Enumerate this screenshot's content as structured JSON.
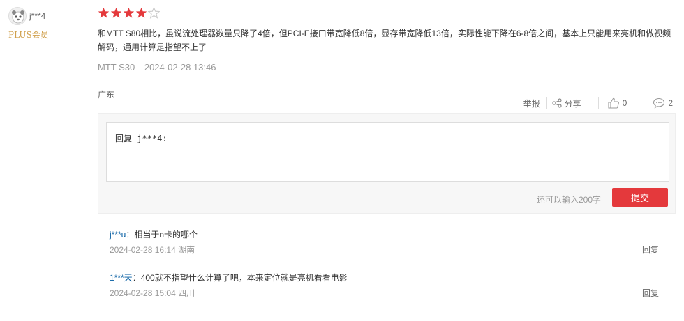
{
  "user": {
    "name": "j***4",
    "badge": "PLUS会员"
  },
  "review": {
    "rating": 4,
    "max_rating": 5,
    "text": "和MTT S80相比，虽说流处理器数量只降了4倍，但PCI-E接口带宽降低8倍，显存带宽降低13倍，实际性能下降在6-8倍之间，基本上只能用来亮机和做视频解码，通用计算是指望不上了",
    "product": "MTT S30",
    "datetime": "2024-02-28 13:46",
    "location": "广东"
  },
  "actions": {
    "report": "举报",
    "share": "分享",
    "likes": "0",
    "comments": "2"
  },
  "reply_box": {
    "placeholder": "回复 j***4:",
    "char_hint": "还可以输入200字",
    "submit": "提交"
  },
  "replies": [
    {
      "user": "j***u",
      "text": "：相当于n卡的哪个",
      "datetime": "2024-02-28 16:14",
      "location": "湖南",
      "reply_label": "回复"
    },
    {
      "user": "1***天",
      "text": "：400就不指望什么计算了吧，本来定位就是亮机看看电影",
      "datetime": "2024-02-28 15:04",
      "location": "四川",
      "reply_label": "回复"
    }
  ],
  "colors": {
    "star": "#e4393c",
    "star_empty": "#cccccc",
    "submit": "#e4393c",
    "reply_user": "#005aa0",
    "plus_badge": "#d0a04c"
  }
}
